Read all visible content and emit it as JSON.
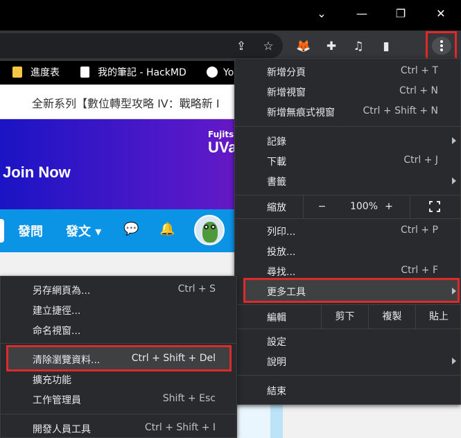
{
  "window": {
    "minimize": "⌄",
    "min": "—",
    "restore": "❐",
    "close": "✕"
  },
  "toolbar": {
    "share": "⇪",
    "star": "☆",
    "fox": "🦊",
    "puzzle": "✚",
    "playlist": "♫",
    "sidepanel": "▮"
  },
  "bookmarks": [
    {
      "label": "進度表"
    },
    {
      "label": "我的筆記 - HackMD"
    },
    {
      "label": "Yo"
    }
  ],
  "page": {
    "announcement": "全新系列【數位轉型攻略 IV：戰略新 I",
    "banner_join": "Join Now",
    "banner_brand_a": "Fujitsu",
    "banner_brand_b": "UVa",
    "nav_ask": "發問",
    "nav_post": "發文 ▾",
    "nav_chat": "💬",
    "nav_bell": "🔔"
  },
  "main_menu": {
    "new_tab": "新增分頁",
    "new_tab_sc": "Ctrl + T",
    "new_window": "新增視窗",
    "new_window_sc": "Ctrl + N",
    "incognito": "新增無痕式視窗",
    "incognito_sc": "Ctrl + Shift + N",
    "history": "記錄",
    "downloads": "下載",
    "downloads_sc": "Ctrl + J",
    "bookmarks": "書籤",
    "zoom": "縮放",
    "zoom_minus": "−",
    "zoom_value": "100%",
    "zoom_plus": "+",
    "print": "列印...",
    "print_sc": "Ctrl + P",
    "cast": "投放...",
    "find": "尋找...",
    "find_sc": "Ctrl + F",
    "more_tools": "更多工具",
    "edit": "編輯",
    "cut": "剪下",
    "copy": "複製",
    "paste": "貼上",
    "settings": "設定",
    "help": "說明",
    "exit": "結束"
  },
  "sub_menu": {
    "save_page": "另存網頁為...",
    "save_page_sc": "Ctrl + S",
    "create_shortcut": "建立捷徑...",
    "name_window": "命名視窗...",
    "clear_data": "清除瀏覽資料...",
    "clear_data_sc": "Ctrl + Shift + Del",
    "extensions": "擴充功能",
    "task_manager": "工作管理員",
    "task_manager_sc": "Shift + Esc",
    "dev_tools": "開發人員工具",
    "dev_tools_sc": "Ctrl + Shift + I"
  },
  "colors": {
    "highlight": "#e02a2a",
    "menu_bg": "#292a2d",
    "nav_blue": "#0b93e5"
  }
}
